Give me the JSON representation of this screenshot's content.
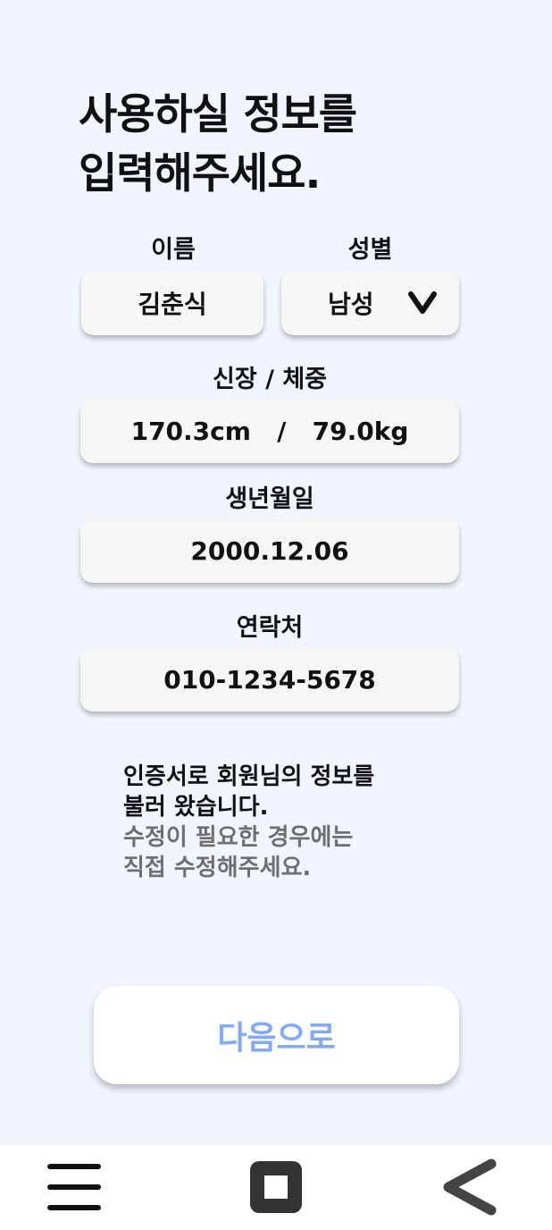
{
  "page": {
    "title_line1": "사용하실 정보를",
    "title_line2": "입력해주세요."
  },
  "form": {
    "name": {
      "label": "이름",
      "value": "김춘식"
    },
    "gender": {
      "label": "성별",
      "value": "남성",
      "icon": "chevron-down-icon"
    },
    "body": {
      "label": "신장 / 체중",
      "value": "170.3cm   /   79.0kg"
    },
    "birth": {
      "label": "생년월일",
      "value": "2000.12.06"
    },
    "phone": {
      "label": "연락처",
      "value": "010-1234-5678"
    }
  },
  "notice": {
    "line1": "인증서로 회원님의 정보를",
    "line2": "불러 왔습니다.",
    "line3": "수정이 필요한 경우에는",
    "line4": "직접 수정해주세요."
  },
  "actions": {
    "next_label": "다음으로"
  },
  "navbar": {
    "items": [
      "menu-icon",
      "home-square-icon",
      "back-icon"
    ]
  },
  "colors": {
    "background": "#f1f6fe",
    "field": "#f6f6f6",
    "next_text": "#82aaf5",
    "secondary_text": "#6f6f6f"
  }
}
